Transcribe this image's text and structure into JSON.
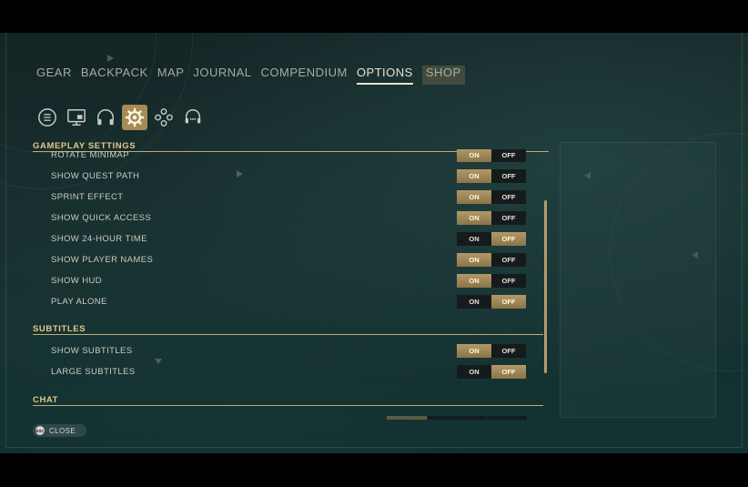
{
  "nav": {
    "tabs": [
      {
        "label": "GEAR"
      },
      {
        "label": "BACKPACK"
      },
      {
        "label": "MAP"
      },
      {
        "label": "JOURNAL"
      },
      {
        "label": "COMPENDIUM"
      },
      {
        "label": "OPTIONS"
      },
      {
        "label": "SHOP"
      }
    ],
    "active": "OPTIONS"
  },
  "category_icons": [
    "list-icon",
    "display-icon",
    "headphones-icon",
    "gear-icon",
    "gamepad-icon",
    "headset-chat-icon"
  ],
  "active_category": "gear-icon",
  "sections": {
    "gameplay": {
      "title": "GAMEPLAY SETTINGS",
      "partial_row": {
        "label": "ROTATE MINIMAP",
        "value": "ON"
      },
      "rows": [
        {
          "label": "SHOW QUEST PATH",
          "value": "ON"
        },
        {
          "label": "SPRINT EFFECT",
          "value": "ON"
        },
        {
          "label": "SHOW QUICK ACCESS",
          "value": "ON"
        },
        {
          "label": "SHOW 24-HOUR TIME",
          "value": "OFF"
        },
        {
          "label": "SHOW PLAYER NAMES",
          "value": "ON"
        },
        {
          "label": "SHOW HUD",
          "value": "ON"
        },
        {
          "label": "PLAY ALONE",
          "value": "OFF"
        }
      ]
    },
    "subtitles": {
      "title": "SUBTITLES",
      "rows": [
        {
          "label": "SHOW SUBTITLES",
          "value": "ON"
        },
        {
          "label": "LARGE SUBTITLES",
          "value": "OFF"
        }
      ]
    },
    "chat": {
      "title": "CHAT"
    }
  },
  "toggle_labels": {
    "on": "ON",
    "off": "OFF"
  },
  "footer": {
    "key": "ESC",
    "close_label": "CLOSE"
  },
  "colors": {
    "accent": "#c2ab72",
    "selected": "#a58b55",
    "text": "#c9cdbf"
  }
}
